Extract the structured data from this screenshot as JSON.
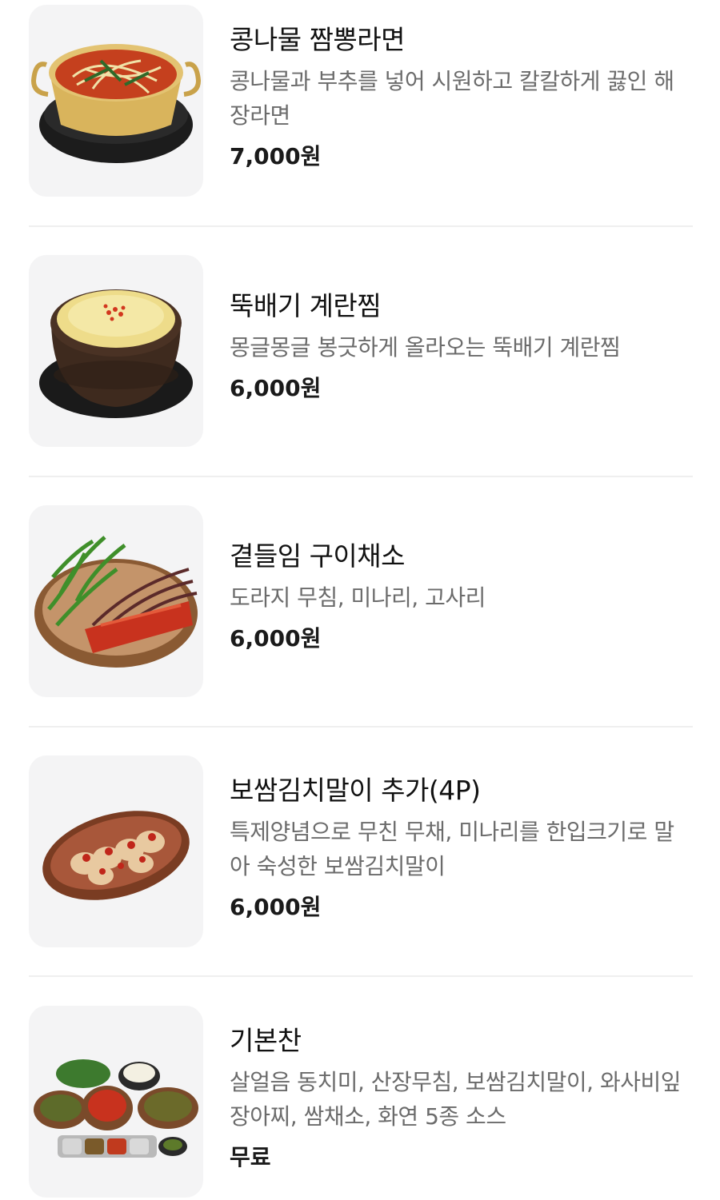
{
  "menu": {
    "items": [
      {
        "name": "콩나물 짬뽕라면",
        "description": "콩나물과 부추를 넣어 시원하고 칼칼하게 끓인 해장라면",
        "price": "7,000원",
        "image_icon": "ramen-pot-image"
      },
      {
        "name": "뚝배기 계란찜",
        "description": "몽글몽글 봉긋하게 올라오는 뚝배기 계란찜",
        "price": "6,000원",
        "image_icon": "steamed-egg-image"
      },
      {
        "name": "곁들임 구이채소",
        "description": "도라지 무침, 미나리, 고사리",
        "price": "6,000원",
        "image_icon": "grilled-vegetables-image"
      },
      {
        "name": "보쌈김치말이 추가(4P)",
        "description": "특제양념으로 무친 무채, 미나리를 한입크기로 말아 숙성한 보쌈김치말이",
        "price": "6,000원",
        "image_icon": "kimchi-roll-image"
      },
      {
        "name": "기본찬",
        "description": "살얼음 동치미, 산장무침, 보쌈김치말이, 와사비잎 장아찌, 쌈채소, 화연 5종 소스",
        "price": "무료",
        "image_icon": "side-dishes-image"
      }
    ]
  }
}
